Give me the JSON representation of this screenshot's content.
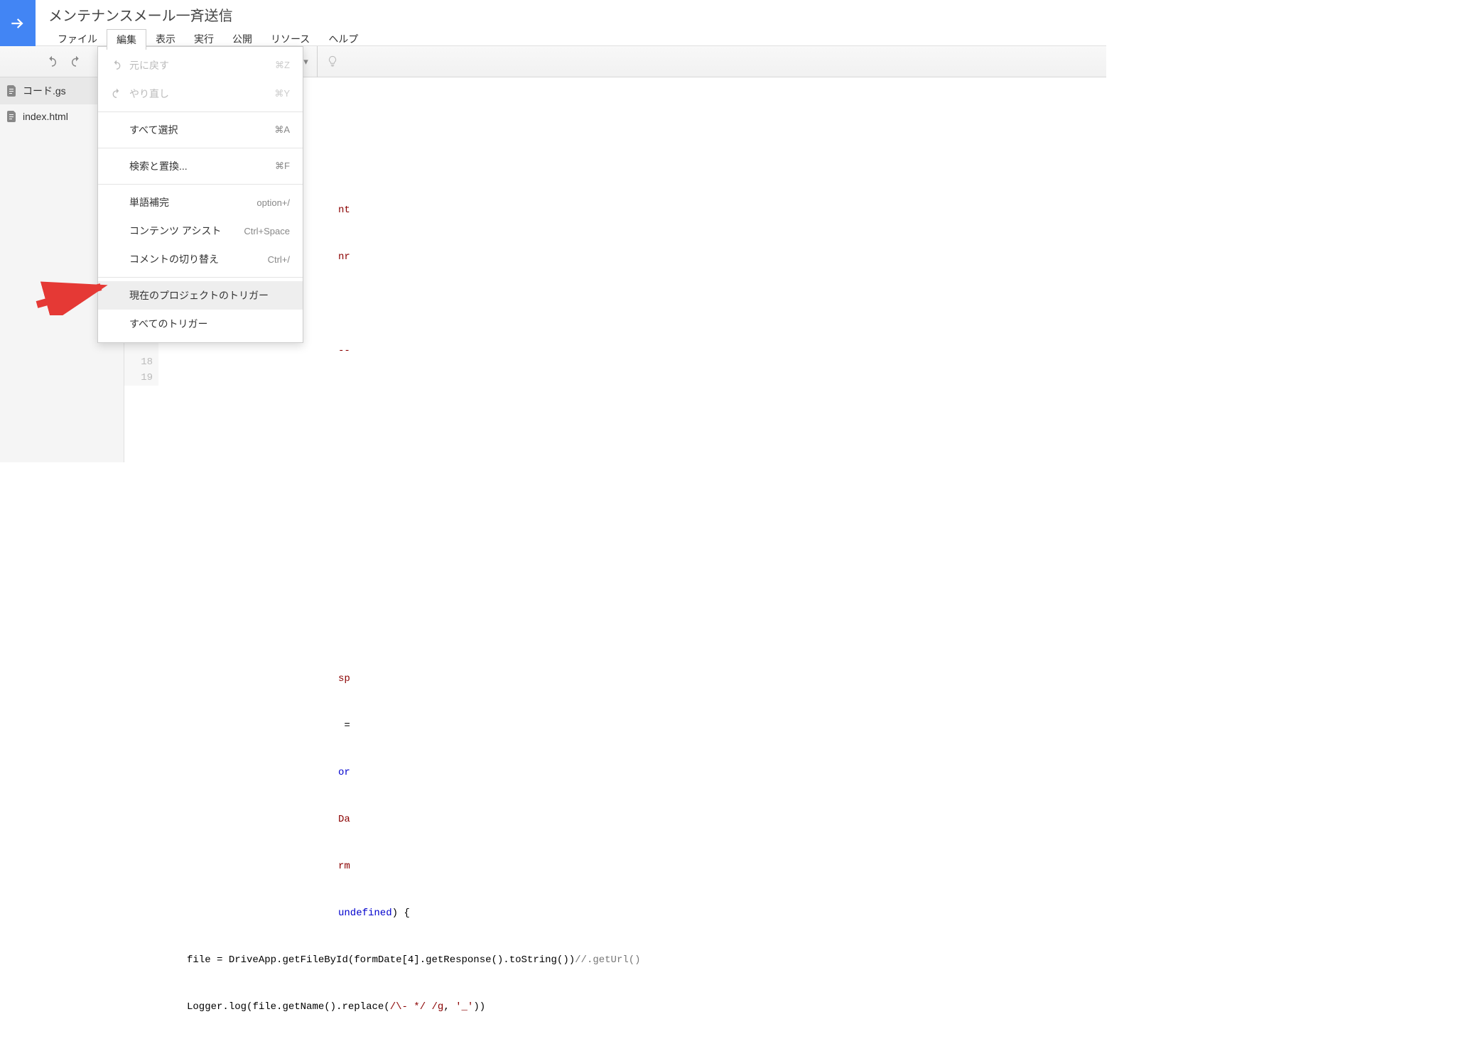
{
  "header": {
    "title": "メンテナンスメール一斉送信"
  },
  "menubar": {
    "items": [
      {
        "label": "ファイル"
      },
      {
        "label": "編集"
      },
      {
        "label": "表示"
      },
      {
        "label": "実行"
      },
      {
        "label": "公開"
      },
      {
        "label": "リソース"
      },
      {
        "label": "ヘルプ"
      }
    ]
  },
  "sidebar": {
    "files": [
      {
        "name": "コード.gs"
      },
      {
        "name": "index.html"
      }
    ]
  },
  "dropdown": {
    "undo": {
      "label": "元に戻す",
      "shortcut": "⌘Z"
    },
    "redo": {
      "label": "やり直し",
      "shortcut": "⌘Y"
    },
    "selectAll": {
      "label": "すべて選択",
      "shortcut": "⌘A"
    },
    "findReplace": {
      "label": "検索と置換...",
      "shortcut": "⌘F"
    },
    "wordComplete": {
      "label": "単語補完",
      "shortcut": "option+/"
    },
    "contentAssist": {
      "label": "コンテンツ アシスト",
      "shortcut": "Ctrl+Space"
    },
    "toggleComment": {
      "label": "コメントの切り替え",
      "shortcut": "Ctrl+/"
    },
    "currentTriggers": {
      "label": "現在のプロジェクトのトリガー"
    },
    "allTriggers": {
      "label": "すべてのトリガー"
    }
  },
  "editor": {
    "lineNumbers": [
      "18",
      "19"
    ],
    "fragments": {
      "nt": "nt",
      "nr": "nr",
      "dash": "--",
      "sp": "sp",
      "eq": " =",
      "or": "or",
      "da": "Da",
      "rm": "rm",
      "undefined": "undefined",
      "brace": ") {",
      "file": "file",
      "eq2": " = ",
      "driveapp": "DriveApp",
      "getfile": ".getFileById(",
      "formdate": "formDate",
      "idx": "[4].",
      "getresp": "getResponse().toString())",
      "comment": "//.getUrl()",
      "logger": "Logger",
      "log": ".log(",
      "file2": "file",
      "getname": ".getName().replace(",
      "regex": "/\\- */ /g",
      "comma": ", ",
      "str": "'_'",
      "close": "))"
    }
  }
}
